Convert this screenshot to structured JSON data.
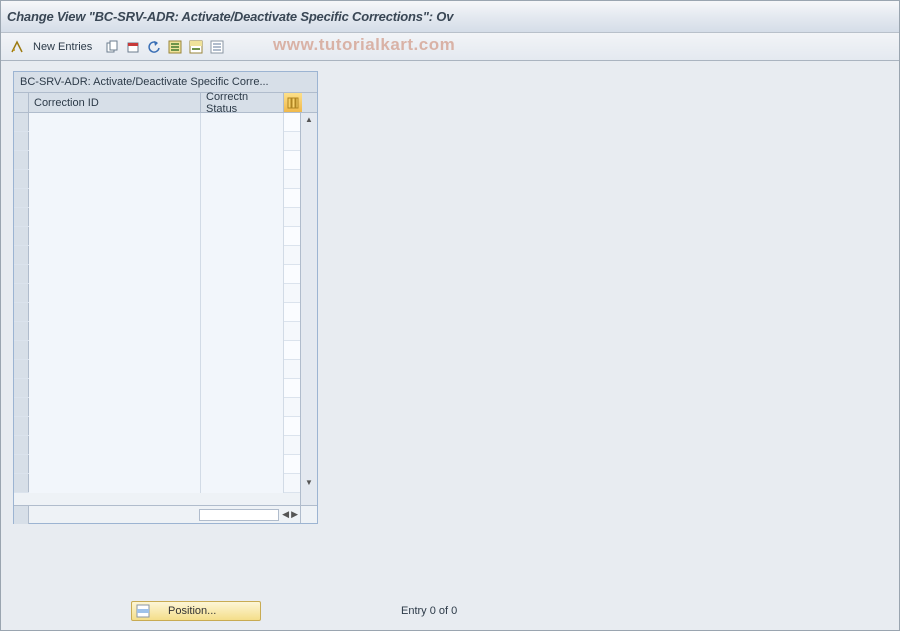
{
  "title": "Change View \"BC-SRV-ADR: Activate/Deactivate Specific Corrections\": Ov",
  "watermark": "www.tutorialkart.com",
  "toolbar": {
    "new_entries": "New Entries"
  },
  "table": {
    "title": "BC-SRV-ADR: Activate/Deactivate Specific Corre...",
    "col1": "Correction ID",
    "col2": "Correctn Status",
    "row_count": 20
  },
  "footer": {
    "position_label": "Position...",
    "entry_label": "Entry 0 of 0"
  }
}
